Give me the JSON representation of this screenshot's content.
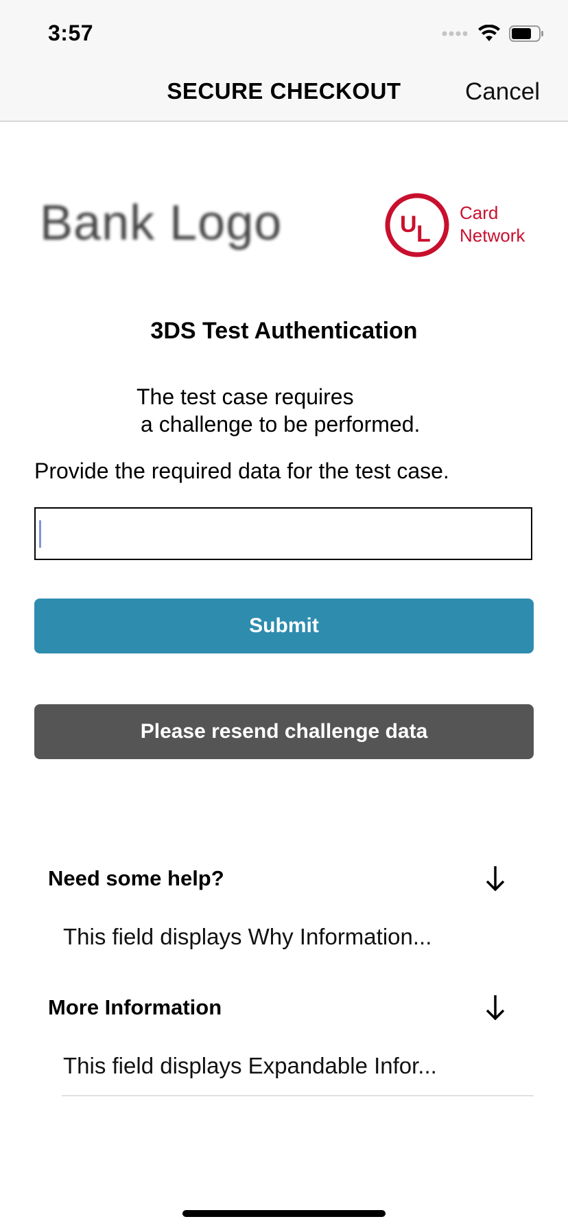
{
  "status_bar": {
    "time": "3:57"
  },
  "nav": {
    "title": "SECURE CHECKOUT",
    "cancel_label": "Cancel"
  },
  "logos": {
    "bank": "Bank Logo",
    "network_line1": "Card",
    "network_line2": "Network"
  },
  "challenge": {
    "heading": "3DS Test Authentication",
    "info_line1": "The test case requires",
    "info_line2": "a challenge to be performed.",
    "instruction": "Provide the required data for the test case.",
    "input_value": "",
    "submit_label": "Submit",
    "resend_label": "Please resend challenge data"
  },
  "help": {
    "title": "Need some help?",
    "body": "This field displays Why Information..."
  },
  "more_info": {
    "title": "More Information",
    "body": "This field displays Expandable Infor..."
  },
  "colors": {
    "primary_button": "#2e8caf",
    "secondary_button": "#555555",
    "network_red": "#c8102e"
  }
}
